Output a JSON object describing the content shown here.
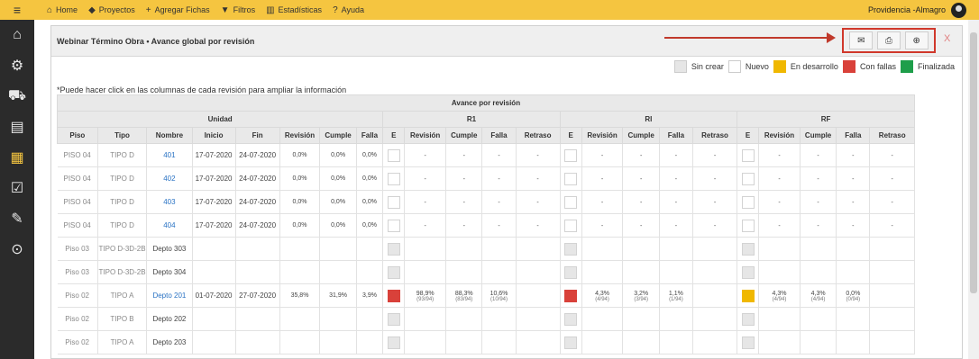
{
  "topbar": {
    "menu_icon": "hamburger-icon",
    "nav": [
      {
        "label": "Home",
        "icon": "home-icon"
      },
      {
        "label": "Proyectos",
        "icon": "tag-icon"
      },
      {
        "label": "Agregar Fichas",
        "icon": "plus-icon"
      },
      {
        "label": "Filtros",
        "icon": "filter-icon"
      },
      {
        "label": "Estadísticas",
        "icon": "chart-icon"
      },
      {
        "label": "Ayuda",
        "icon": "help-icon"
      }
    ],
    "user": "Providencia -Almagro"
  },
  "panel": {
    "title": "Webinar Término Obra • Avance global por revisión",
    "close": "X"
  },
  "legend": [
    {
      "label": "Sin crear",
      "color": "#e6e6e6"
    },
    {
      "label": "Nuevo",
      "color": "#ffffff"
    },
    {
      "label": "En desarrollo",
      "color": "#f0b800"
    },
    {
      "label": "Con fallas",
      "color": "#d9413a"
    },
    {
      "label": "Finalizada",
      "color": "#1e9e4a"
    }
  ],
  "note": "*Puede hacer click en las columnas de cada revisión para ampliar la información",
  "table": {
    "top_header": "Avance por revisión",
    "group_unidad": "Unidad",
    "group_r1": "R1",
    "group_ri": "RI",
    "group_rf": "RF",
    "columns": [
      "Piso",
      "Tipo",
      "Nombre",
      "Inicio",
      "Fin",
      "Revisión",
      "Cumple",
      "Falla",
      "E",
      "Revisión",
      "Cumple",
      "Falla",
      "Retraso",
      "E",
      "Revisión",
      "Cumple",
      "Falla",
      "Retraso",
      "E",
      "Revisión",
      "Cumple",
      "Falla",
      "Retraso"
    ],
    "rows": [
      {
        "piso": "PISO 04",
        "tipo": "TIPO D",
        "nombre": "401",
        "inicio": "17-07-2020",
        "fin": "24-07-2020",
        "rev": "0,0%",
        "cumple": "0,0%",
        "falla": "0,0%",
        "r1": [
          "-",
          "-",
          "-",
          "-"
        ],
        "ri": [
          "-",
          "-",
          "-",
          "-"
        ],
        "rf": [
          "-",
          "-",
          "-",
          "-"
        ],
        "boxes": [
          "",
          "",
          ""
        ]
      },
      {
        "piso": "PISO 04",
        "tipo": "TIPO D",
        "nombre": "402",
        "inicio": "17-07-2020",
        "fin": "24-07-2020",
        "rev": "0,0%",
        "cumple": "0,0%",
        "falla": "0,0%",
        "r1": [
          "-",
          "-",
          "-",
          "-"
        ],
        "ri": [
          "-",
          "-",
          "-",
          "-"
        ],
        "rf": [
          "-",
          "-",
          "-",
          "-"
        ],
        "boxes": [
          "",
          "",
          ""
        ]
      },
      {
        "piso": "PISO 04",
        "tipo": "TIPO D",
        "nombre": "403",
        "inicio": "17-07-2020",
        "fin": "24-07-2020",
        "rev": "0,0%",
        "cumple": "0,0%",
        "falla": "0,0%",
        "r1": [
          "-",
          "-",
          "-",
          "-"
        ],
        "ri": [
          "-",
          "-",
          "-",
          "-"
        ],
        "rf": [
          "-",
          "-",
          "-",
          "-"
        ],
        "boxes": [
          "",
          "",
          ""
        ]
      },
      {
        "piso": "PISO 04",
        "tipo": "TIPO D",
        "nombre": "404",
        "inicio": "17-07-2020",
        "fin": "24-07-2020",
        "rev": "0,0%",
        "cumple": "0,0%",
        "falla": "0,0%",
        "r1": [
          "-",
          "-",
          "-",
          "-"
        ],
        "ri": [
          "-",
          "-",
          "-",
          "-"
        ],
        "rf": [
          "-",
          "-",
          "-",
          "-"
        ],
        "boxes": [
          "",
          "",
          ""
        ]
      },
      {
        "piso": "Piso 03",
        "tipo": "TIPO D-3D-2B",
        "nombre": "Depto 303",
        "inicio": "",
        "fin": "",
        "rev": "",
        "cumple": "",
        "falla": "",
        "r1": [
          "",
          "",
          "",
          ""
        ],
        "ri": [
          "",
          "",
          "",
          ""
        ],
        "rf": [
          "",
          "",
          "",
          ""
        ],
        "boxes": [
          "grey",
          "grey",
          "grey"
        ]
      },
      {
        "piso": "Piso 03",
        "tipo": "TIPO D-3D-2B",
        "nombre": "Depto 304",
        "inicio": "",
        "fin": "",
        "rev": "",
        "cumple": "",
        "falla": "",
        "r1": [
          "",
          "",
          "",
          ""
        ],
        "ri": [
          "",
          "",
          "",
          ""
        ],
        "rf": [
          "",
          "",
          "",
          ""
        ],
        "boxes": [
          "grey",
          "grey",
          "grey"
        ]
      },
      {
        "piso": "Piso 02",
        "tipo": "TIPO A",
        "nombre": "Depto 201",
        "inicio": "01-07-2020",
        "fin": "27-07-2020",
        "rev": "35,8%",
        "cumple": "31,9%",
        "falla": "3,9%",
        "r1": [
          "98,9%",
          "88,3%",
          "10,6%",
          ""
        ],
        "r1_sub": [
          "(93/94)",
          "(83/94)",
          "(10/94)",
          ""
        ],
        "ri": [
          "4,3%",
          "3,2%",
          "1,1%",
          ""
        ],
        "ri_sub": [
          "(4/94)",
          "(3/94)",
          "(1/94)",
          ""
        ],
        "rf": [
          "4,3%",
          "4,3%",
          "0,0%",
          ""
        ],
        "rf_sub": [
          "(4/94)",
          "(4/94)",
          "(0/94)",
          ""
        ],
        "boxes": [
          "red",
          "red",
          "yellow"
        ]
      },
      {
        "piso": "Piso 02",
        "tipo": "TIPO B",
        "nombre": "Depto 202",
        "inicio": "",
        "fin": "",
        "rev": "",
        "cumple": "",
        "falla": "",
        "r1": [
          "",
          "",
          "",
          ""
        ],
        "ri": [
          "",
          "",
          "",
          ""
        ],
        "rf": [
          "",
          "",
          "",
          ""
        ],
        "boxes": [
          "grey",
          "grey",
          "grey"
        ]
      },
      {
        "piso": "Piso 02",
        "tipo": "TIPO A",
        "nombre": "Depto 203",
        "inicio": "",
        "fin": "",
        "rev": "",
        "cumple": "",
        "falla": "",
        "r1": [
          "",
          "",
          "",
          ""
        ],
        "ri": [
          "",
          "",
          "",
          ""
        ],
        "rf": [
          "",
          "",
          "",
          ""
        ],
        "boxes": [
          "grey",
          "grey",
          "grey"
        ]
      }
    ]
  },
  "sidebar": [
    {
      "icon": "home-icon"
    },
    {
      "icon": "settings-icon"
    },
    {
      "icon": "truck-icon"
    },
    {
      "icon": "document-icon"
    },
    {
      "icon": "report-icon",
      "active": true
    },
    {
      "icon": "checklist-icon"
    },
    {
      "icon": "tools-icon"
    },
    {
      "icon": "search-stats-icon"
    }
  ]
}
